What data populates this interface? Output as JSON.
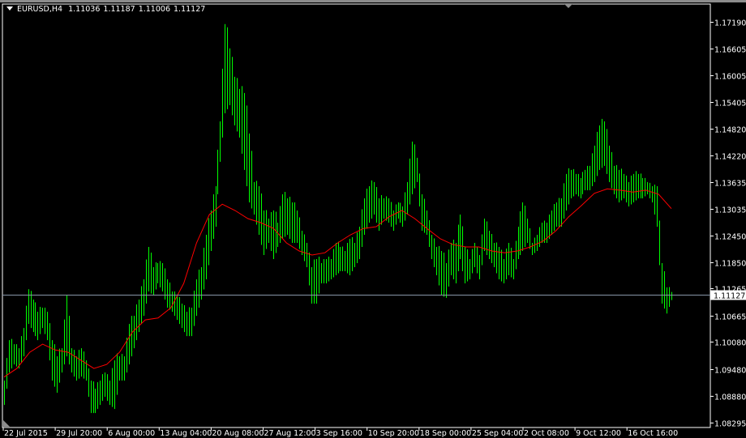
{
  "window": {
    "symbol": "EURUSD,H4",
    "ohlc": [
      "1.11036",
      "1.11187",
      "1.11006",
      "1.11127"
    ]
  },
  "chart_data": {
    "type": "bar",
    "symbol": "EURUSD",
    "timeframe": "H4",
    "price_axis": {
      "ylim": [
        1.0812,
        1.1756
      ],
      "ticks": [
        "1.17190",
        "1.16605",
        "1.16005",
        "1.15405",
        "1.14820",
        "1.14220",
        "1.13635",
        "1.13035",
        "1.12450",
        "1.11850",
        "1.11265",
        "1.10665",
        "1.10080",
        "1.09480",
        "1.08880",
        "1.08295"
      ]
    },
    "time_axis": {
      "ticks": [
        "22 Jul 2015",
        "29 Jul 20:00",
        "6 Aug 00:00",
        "13 Aug 04:00",
        "20 Aug 08:00",
        "27 Aug 12:00",
        "3 Sep 16:00",
        "10 Sep 20:00",
        "18 Sep 00:00",
        "25 Sep 04:00",
        "2 Oct 08:00",
        "9 Oct 12:00",
        "16 Oct 16:00"
      ]
    },
    "current_price": "1.11127",
    "colors": {
      "bars": "#00ff00",
      "ma": "#ff0000",
      "bid_line": "#8796a8",
      "background": "#000000",
      "axis": "#ffffff"
    },
    "bars_high_low": [
      [
        1.0922,
        1.0868
      ],
      [
        1.1012,
        1.094
      ],
      [
        1.1003,
        1.0958
      ],
      [
        1.0994,
        1.0949
      ],
      [
        1.1039,
        1.0976
      ],
      [
        1.1125,
        1.1048
      ],
      [
        1.1102,
        1.103
      ],
      [
        1.1075,
        1.1012
      ],
      [
        1.1084,
        1.1039
      ],
      [
        1.1075,
        1.1012
      ],
      [
        1.1012,
        1.0922
      ],
      [
        1.0976,
        1.0895
      ],
      [
        1.0994,
        1.094
      ],
      [
        1.1111,
        1.0976
      ],
      [
        1.0994,
        1.094
      ],
      [
        1.0976,
        1.0922
      ],
      [
        1.0994,
        1.0931
      ],
      [
        1.0967,
        1.0922
      ],
      [
        1.0922,
        1.085
      ],
      [
        1.0904,
        1.085
      ],
      [
        1.0922,
        1.0868
      ],
      [
        1.094,
        1.0886
      ],
      [
        1.0922,
        1.0868
      ],
      [
        1.0967,
        1.0859
      ],
      [
        1.0976,
        1.0922
      ],
      [
        1.0976,
        1.0922
      ],
      [
        1.1048,
        1.0958
      ],
      [
        1.1066,
        1.0994
      ],
      [
        1.1102,
        1.103
      ],
      [
        1.1147,
        1.1066
      ],
      [
        1.1219,
        1.112
      ],
      [
        1.1174,
        1.1111
      ],
      [
        1.1183,
        1.1138
      ],
      [
        1.1183,
        1.112
      ],
      [
        1.1147,
        1.1084
      ],
      [
        1.112,
        1.1075
      ],
      [
        1.1111,
        1.1057
      ],
      [
        1.1093,
        1.1039
      ],
      [
        1.1075,
        1.1021
      ],
      [
        1.1084,
        1.1021
      ],
      [
        1.1147,
        1.1066
      ],
      [
        1.1174,
        1.1102
      ],
      [
        1.1246,
        1.1147
      ],
      [
        1.13,
        1.121
      ],
      [
        1.1354,
        1.1264
      ],
      [
        1.1498,
        1.1408
      ],
      [
        1.1714,
        1.1516
      ],
      [
        1.166,
        1.1534
      ],
      [
        1.1597,
        1.1489
      ],
      [
        1.157,
        1.1462
      ],
      [
        1.1561,
        1.139
      ],
      [
        1.1471,
        1.1318
      ],
      [
        1.1363,
        1.1291
      ],
      [
        1.1354,
        1.1246
      ],
      [
        1.13,
        1.1201
      ],
      [
        1.1282,
        1.1228
      ],
      [
        1.13,
        1.1192
      ],
      [
        1.1273,
        1.1219
      ],
      [
        1.1336,
        1.1237
      ],
      [
        1.1327,
        1.1246
      ],
      [
        1.1318,
        1.1228
      ],
      [
        1.13,
        1.1228
      ],
      [
        1.1255,
        1.1201
      ],
      [
        1.1228,
        1.1174
      ],
      [
        1.1174,
        1.1093
      ],
      [
        1.1192,
        1.1093
      ],
      [
        1.1183,
        1.1138
      ],
      [
        1.1192,
        1.1138
      ],
      [
        1.1192,
        1.1147
      ],
      [
        1.1228,
        1.1156
      ],
      [
        1.1219,
        1.1165
      ],
      [
        1.121,
        1.1165
      ],
      [
        1.1237,
        1.1156
      ],
      [
        1.1228,
        1.1174
      ],
      [
        1.1264,
        1.1192
      ],
      [
        1.1327,
        1.1246
      ],
      [
        1.1354,
        1.1273
      ],
      [
        1.1363,
        1.1291
      ],
      [
        1.1327,
        1.1255
      ],
      [
        1.1327,
        1.1282
      ],
      [
        1.1327,
        1.1273
      ],
      [
        1.13,
        1.1255
      ],
      [
        1.1318,
        1.1282
      ],
      [
        1.1309,
        1.1264
      ],
      [
        1.1363,
        1.1291
      ],
      [
        1.1453,
        1.1336
      ],
      [
        1.1417,
        1.1363
      ],
      [
        1.1336,
        1.1255
      ],
      [
        1.13,
        1.1246
      ],
      [
        1.1246,
        1.1192
      ],
      [
        1.1219,
        1.1156
      ],
      [
        1.121,
        1.1111
      ],
      [
        1.1183,
        1.1106
      ],
      [
        1.1228,
        1.1156
      ],
      [
        1.1228,
        1.1138
      ],
      [
        1.1291,
        1.1192
      ],
      [
        1.1219,
        1.1138
      ],
      [
        1.1192,
        1.1147
      ],
      [
        1.1228,
        1.1174
      ],
      [
        1.1201,
        1.1147
      ],
      [
        1.1282,
        1.121
      ],
      [
        1.1255,
        1.1192
      ],
      [
        1.1228,
        1.1174
      ],
      [
        1.1219,
        1.1147
      ],
      [
        1.1192,
        1.1138
      ],
      [
        1.1228,
        1.1156
      ],
      [
        1.1192,
        1.1147
      ],
      [
        1.1264,
        1.1192
      ],
      [
        1.1318,
        1.121
      ],
      [
        1.1282,
        1.1228
      ],
      [
        1.1228,
        1.1201
      ],
      [
        1.1246,
        1.121
      ],
      [
        1.1273,
        1.1228
      ],
      [
        1.1273,
        1.1228
      ],
      [
        1.13,
        1.1246
      ],
      [
        1.1318,
        1.1264
      ],
      [
        1.1327,
        1.1264
      ],
      [
        1.1381,
        1.13
      ],
      [
        1.139,
        1.1327
      ],
      [
        1.1381,
        1.1336
      ],
      [
        1.1372,
        1.1327
      ],
      [
        1.139,
        1.1345
      ],
      [
        1.1399,
        1.1345
      ],
      [
        1.1444,
        1.1363
      ],
      [
        1.1489,
        1.139
      ],
      [
        1.1498,
        1.1399
      ],
      [
        1.1444,
        1.1363
      ],
      [
        1.1399,
        1.1336
      ],
      [
        1.139,
        1.1318
      ],
      [
        1.1381,
        1.1327
      ],
      [
        1.1363,
        1.1309
      ],
      [
        1.1381,
        1.1318
      ],
      [
        1.1381,
        1.1327
      ],
      [
        1.1372,
        1.1327
      ],
      [
        1.1363,
        1.1336
      ],
      [
        1.1354,
        1.1318
      ],
      [
        1.1354,
        1.1264
      ],
      [
        1.1183,
        1.1093
      ],
      [
        1.1129,
        1.1071
      ],
      [
        1.1119,
        1.1101
      ]
    ],
    "moving_average": [
      1.093,
      1.0949,
      1.0985,
      1.1003,
      1.099,
      1.0985,
      1.0967,
      1.0949,
      1.0958,
      1.0985,
      1.103,
      1.1057,
      1.1061,
      1.1084,
      1.1138,
      1.1228,
      1.1291,
      1.1314,
      1.13,
      1.1282,
      1.1273,
      1.126,
      1.1228,
      1.121,
      1.1201,
      1.1206,
      1.1228,
      1.1246,
      1.126,
      1.1264,
      1.1286,
      1.13,
      1.1282,
      1.1259,
      1.1237,
      1.1224,
      1.1219,
      1.1219,
      1.121,
      1.1206,
      1.121,
      1.1219,
      1.1232,
      1.1255,
      1.1286,
      1.1311,
      1.1338,
      1.1348,
      1.1345,
      1.1341,
      1.1345,
      1.1336,
      1.1304
    ]
  }
}
